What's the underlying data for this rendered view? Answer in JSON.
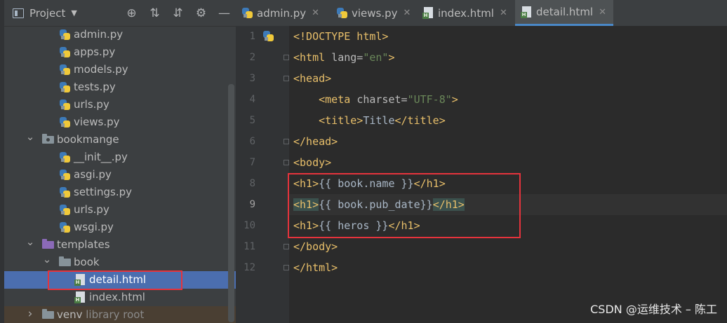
{
  "project_panel": {
    "title": "Project",
    "toolbar_icons": [
      "crosshair-icon",
      "expand-all-icon",
      "collapse-all-icon",
      "gear-icon",
      "minimize-icon"
    ]
  },
  "tree": [
    {
      "label": "admin.py",
      "type": "py",
      "depth": 1
    },
    {
      "label": "apps.py",
      "type": "py",
      "depth": 1
    },
    {
      "label": "models.py",
      "type": "py",
      "depth": 1
    },
    {
      "label": "tests.py",
      "type": "py",
      "depth": 1
    },
    {
      "label": "urls.py",
      "type": "py",
      "depth": 1
    },
    {
      "label": "views.py",
      "type": "py",
      "depth": 1
    },
    {
      "label": "bookmange",
      "type": "package",
      "depth": 0,
      "expanded": true
    },
    {
      "label": "__init__.py",
      "type": "py",
      "depth": 1
    },
    {
      "label": "asgi.py",
      "type": "py",
      "depth": 1
    },
    {
      "label": "settings.py",
      "type": "py",
      "depth": 1
    },
    {
      "label": "urls.py",
      "type": "py",
      "depth": 1
    },
    {
      "label": "wsgi.py",
      "type": "py",
      "depth": 1
    },
    {
      "label": "templates",
      "type": "folder-purple",
      "depth": 0,
      "expanded": true
    },
    {
      "label": "book",
      "type": "folder",
      "depth": 1,
      "expanded": true
    },
    {
      "label": "detail.html",
      "type": "html",
      "depth": 2,
      "selected": true
    },
    {
      "label": "index.html",
      "type": "html",
      "depth": 2
    },
    {
      "label": "venv",
      "type": "folder",
      "depth": 0,
      "expanded": false,
      "suffix": "library root"
    }
  ],
  "tabs": [
    {
      "label": "admin.py",
      "type": "py",
      "active": false
    },
    {
      "label": "views.py",
      "type": "py",
      "active": false
    },
    {
      "label": "index.html",
      "type": "html",
      "active": false
    },
    {
      "label": "detail.html",
      "type": "html",
      "active": true
    }
  ],
  "editor": {
    "current_line": 9,
    "lines": [
      {
        "n": "1",
        "segs": [
          [
            "tag",
            "<!DOCTYPE html>"
          ]
        ]
      },
      {
        "n": "2",
        "segs": [
          [
            "tag",
            "<html "
          ],
          [
            "attr",
            "lang="
          ],
          [
            "str",
            "\"en\""
          ],
          [
            "tag",
            ">"
          ]
        ]
      },
      {
        "n": "3",
        "segs": [
          [
            "tag",
            "<head>"
          ]
        ]
      },
      {
        "n": "4",
        "segs": [
          [
            "txt",
            "    "
          ],
          [
            "tag",
            "<meta "
          ],
          [
            "attr",
            "charset="
          ],
          [
            "str",
            "\"UTF-8\""
          ],
          [
            "tag",
            ">"
          ]
        ]
      },
      {
        "n": "5",
        "segs": [
          [
            "txt",
            "    "
          ],
          [
            "tag",
            "<title>"
          ],
          [
            "txt",
            "Title"
          ],
          [
            "tag",
            "</title>"
          ]
        ]
      },
      {
        "n": "6",
        "segs": [
          [
            "tag",
            "</head>"
          ]
        ]
      },
      {
        "n": "7",
        "segs": [
          [
            "tag",
            "<body>"
          ]
        ]
      },
      {
        "n": "8",
        "segs": [
          [
            "tag",
            "<h1>"
          ],
          [
            "txt",
            "{{ book.name }}"
          ],
          [
            "tag",
            "</h1>"
          ]
        ]
      },
      {
        "n": "9",
        "segs": [
          [
            "tag hl",
            "<h1>"
          ],
          [
            "txt",
            "{{ book.pub_date}}"
          ],
          [
            "tag hl",
            "</h1>"
          ]
        ]
      },
      {
        "n": "10",
        "segs": [
          [
            "tag",
            "<h1>"
          ],
          [
            "txt",
            "{{ heros }}"
          ],
          [
            "tag",
            "</h1>"
          ]
        ]
      },
      {
        "n": "11",
        "segs": [
          [
            "tag",
            "</body>"
          ]
        ]
      },
      {
        "n": "12",
        "segs": [
          [
            "tag",
            "</html>"
          ]
        ]
      }
    ]
  },
  "watermark": "CSDN @运维技术 – 陈工",
  "colors": {
    "selection": "#4b6eaf",
    "annotation": "#e5333c",
    "tag": "#e8bf6a",
    "string": "#6a8759"
  }
}
